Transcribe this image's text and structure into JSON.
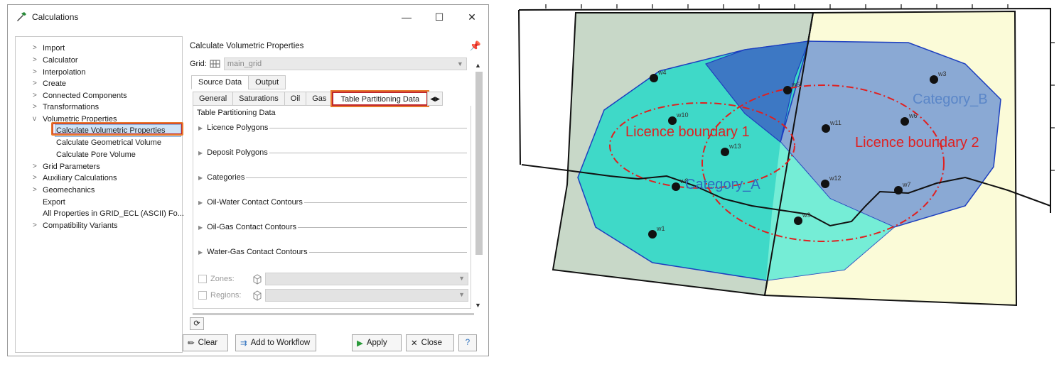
{
  "window": {
    "title": "Calculations",
    "minimize": "—",
    "maximize": "☐",
    "close": "✕"
  },
  "tree": {
    "items": [
      {
        "label": "Import",
        "chevron": ">"
      },
      {
        "label": "Calculator",
        "chevron": ">"
      },
      {
        "label": "Interpolation",
        "chevron": ">"
      },
      {
        "label": "Create",
        "chevron": ">"
      },
      {
        "label": "Connected Components",
        "chevron": ">"
      },
      {
        "label": "Transformations",
        "chevron": ">"
      },
      {
        "label": "Volumetric Properties",
        "chevron": "v"
      },
      {
        "label": "Calculate Volumetric Properties",
        "chevron": ""
      },
      {
        "label": "Calculate Geometrical Volume",
        "chevron": ""
      },
      {
        "label": "Calculate Pore Volume",
        "chevron": ""
      },
      {
        "label": "Grid Parameters",
        "chevron": ">"
      },
      {
        "label": "Auxiliary Calculations",
        "chevron": ">"
      },
      {
        "label": "Geomechanics",
        "chevron": ">"
      },
      {
        "label": "Export",
        "chevron": ""
      },
      {
        "label": "All Properties in GRID_ECL (ASCII) Fo...",
        "chevron": ""
      },
      {
        "label": "Compatibility Variants",
        "chevron": ">"
      }
    ]
  },
  "panel": {
    "title": "Calculate Volumetric Properties",
    "grid_label": "Grid:",
    "grid_value": "main_grid",
    "tabs": [
      "Source Data",
      "Output"
    ],
    "subtabs": [
      "General",
      "Saturations",
      "Oil",
      "Gas",
      "Table Partitioning Data"
    ],
    "group_title": "Table Partitioning Data",
    "sections": [
      "Licence Polygons",
      "Deposit Polygons",
      "Categories",
      "Oil-Water Contact Contours",
      "Oil-Gas Contact Contours",
      "Water-Gas Contact Contours"
    ],
    "zones_label": "Zones:",
    "regions_label": "Regions:"
  },
  "buttons": {
    "clear": "Clear",
    "add_to_workflow": "Add to Workflow",
    "apply": "Apply",
    "close": "Close",
    "help": "?"
  },
  "map": {
    "labels": {
      "licence1": "Licence boundary 1",
      "licence2": "Licence boundary 2",
      "categoryA": "Category_A",
      "categoryB": "Category_B"
    },
    "wells": [
      "w1",
      "w3",
      "w4",
      "w5",
      "w6",
      "w7",
      "w8",
      "w9",
      "w10",
      "w11",
      "w12",
      "w13"
    ],
    "colors": {
      "category_a": "#3fd9c8",
      "category_b": "#8aa9d4",
      "overlap": "#3d78c4",
      "licence": "#e02020",
      "block_left": "#c8d8c8",
      "block_right": "#fbfbd8"
    }
  }
}
